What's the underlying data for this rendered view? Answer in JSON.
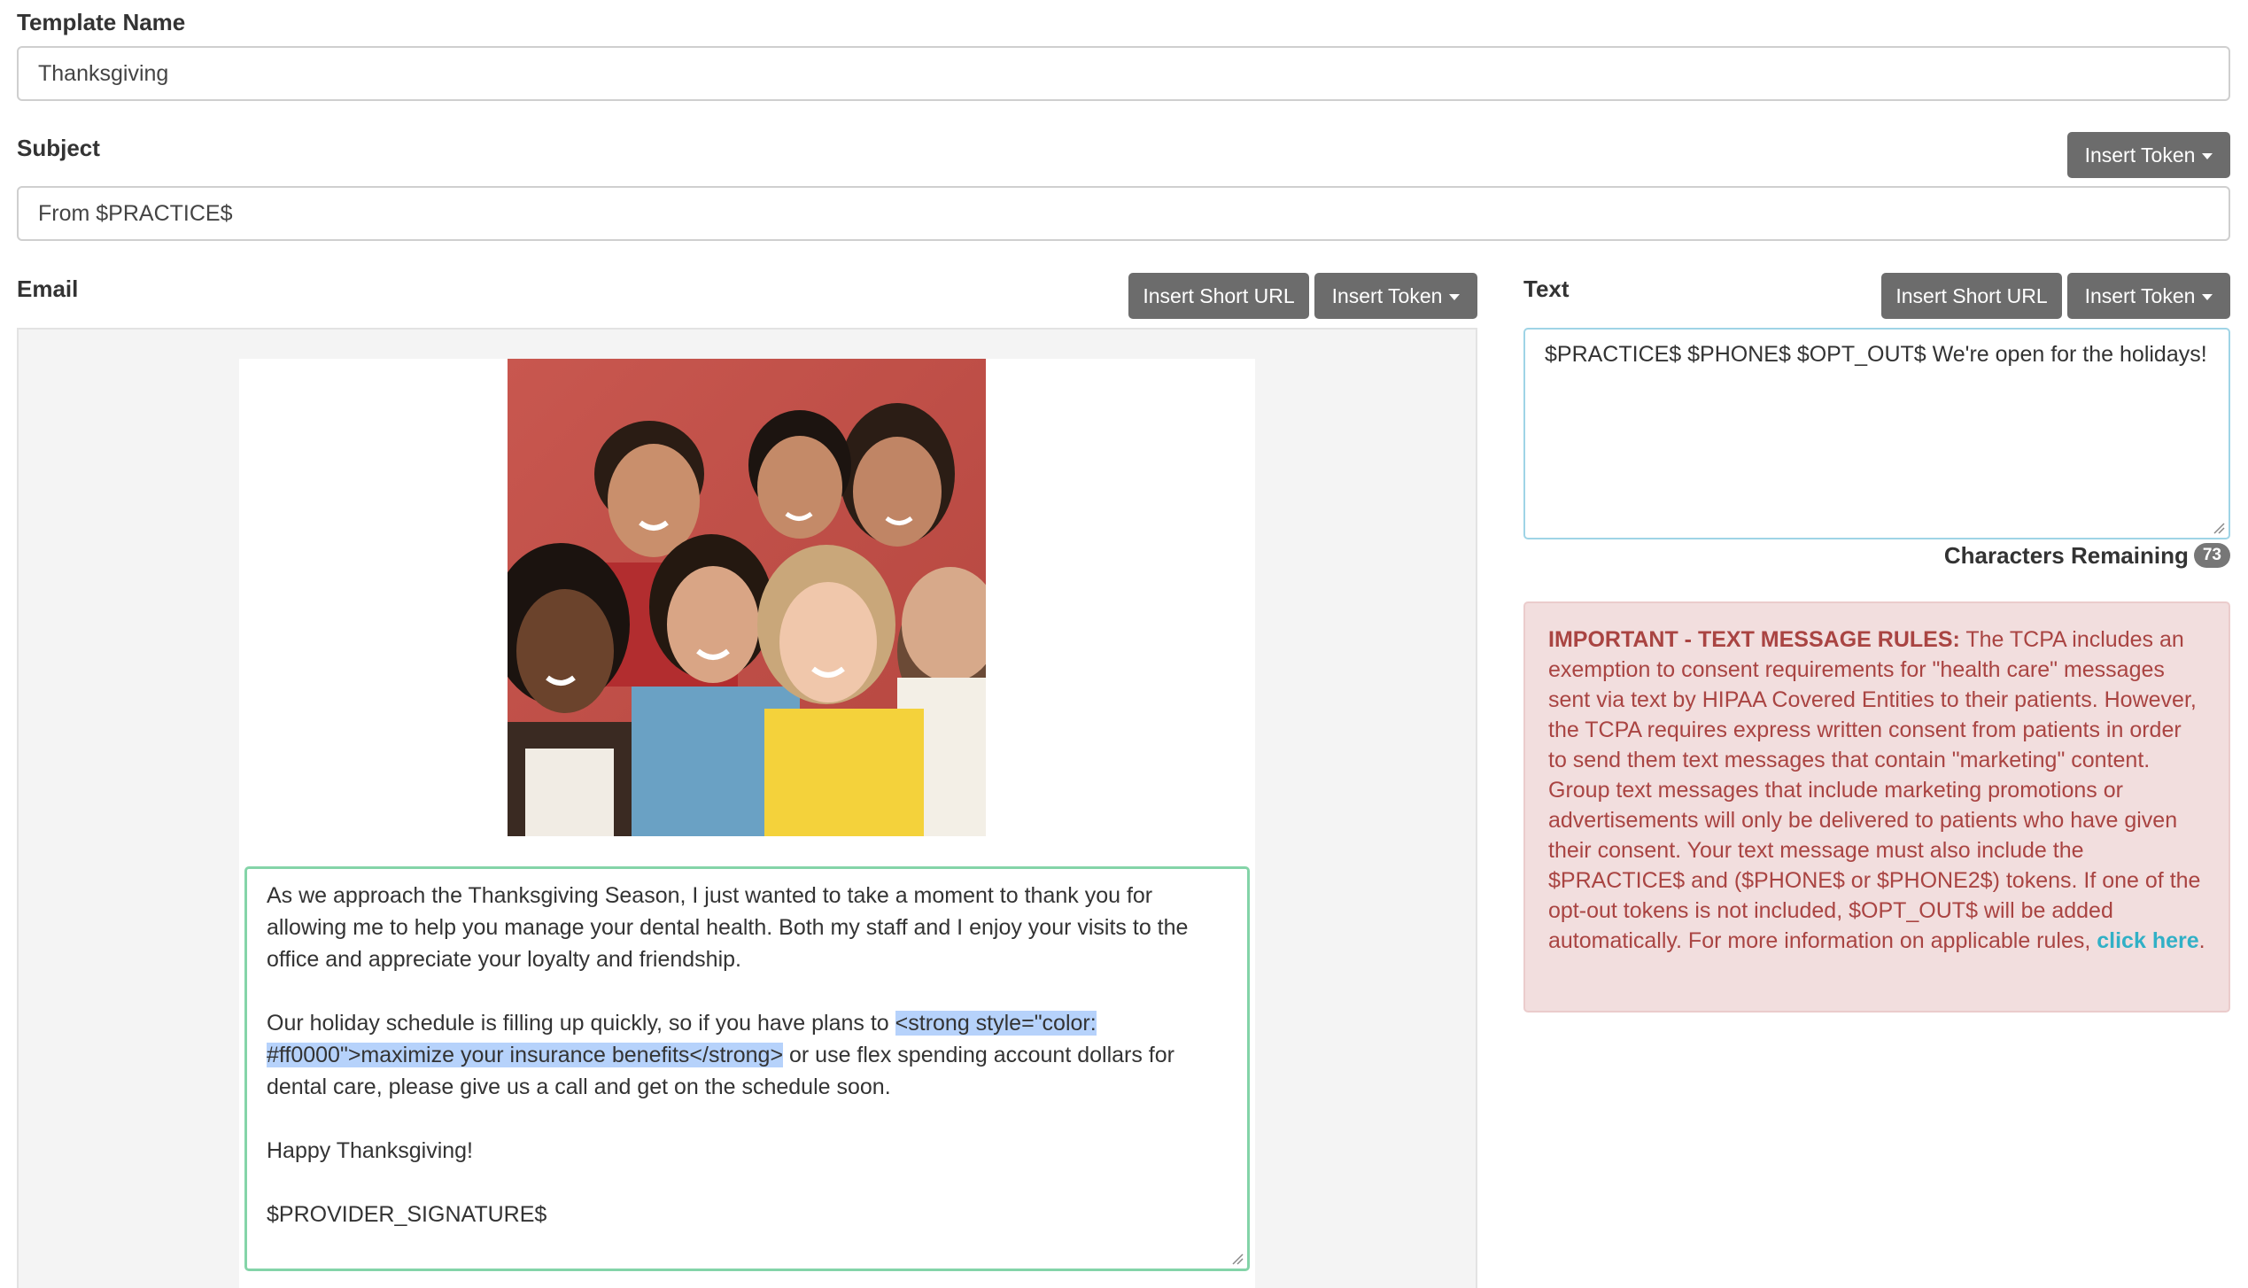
{
  "template_name": {
    "label": "Template Name",
    "value": "Thanksgiving"
  },
  "subject": {
    "label": "Subject",
    "value": "From $PRACTICE$",
    "insert_token_label": "Insert Token"
  },
  "email": {
    "label": "Email",
    "insert_short_url_label": "Insert Short URL",
    "insert_token_label": "Insert Token",
    "image_name": "group-photo",
    "body": {
      "p1": "As we approach the Thanksgiving Season, I just wanted to take a moment to thank you for allowing me to help you manage your dental health. Both my staff and I enjoy your visits to the office and appreciate your loyalty and friendship.",
      "p2_before": "Our holiday schedule is filling up quickly, so if you have plans to ",
      "p2_highlight": "<strong style=\"color: #ff0000\">maximize your insurance benefits</strong>",
      "p2_after": " or use flex spending account dollars for dental care, please give us a call and get on the schedule soon.",
      "p3": "Happy Thanksgiving!",
      "p4": "$PROVIDER_SIGNATURE$"
    }
  },
  "text": {
    "label": "Text",
    "insert_short_url_label": "Insert Short URL",
    "insert_token_label": "Insert Token",
    "value": "$PRACTICE$ $PHONE$ $OPT_OUT$ We're open for the holidays!",
    "chars_remaining_label": "Characters Remaining",
    "chars_remaining": "73"
  },
  "alert": {
    "title": "IMPORTANT - TEXT MESSAGE RULES:",
    "body": " The TCPA includes an exemption to consent requirements for \"health care\" messages sent via text by HIPAA Covered Entities to their patients. However, the TCPA requires express written consent from patients in order to send them text messages that contain \"marketing\" content. Group text messages that include marketing promotions or advertisements will only be delivered to patients who have given their consent. Your text message must also include the $PRACTICE$ and ($PHONE$ or $PHONE2$) tokens. If one of the opt-out tokens is not included, $OPT_OUT$ will be added automatically. For more information on applicable rules, ",
    "link_text": "click here",
    "end": "."
  },
  "colors": {
    "button": "#6c6c6c",
    "alert_bg": "#f2dede",
    "alert_text": "#a94442",
    "link": "#31b0c6",
    "editor_border": "#84d4a8",
    "text_border": "#9fd4e6",
    "highlight": "#b6d2fb"
  }
}
